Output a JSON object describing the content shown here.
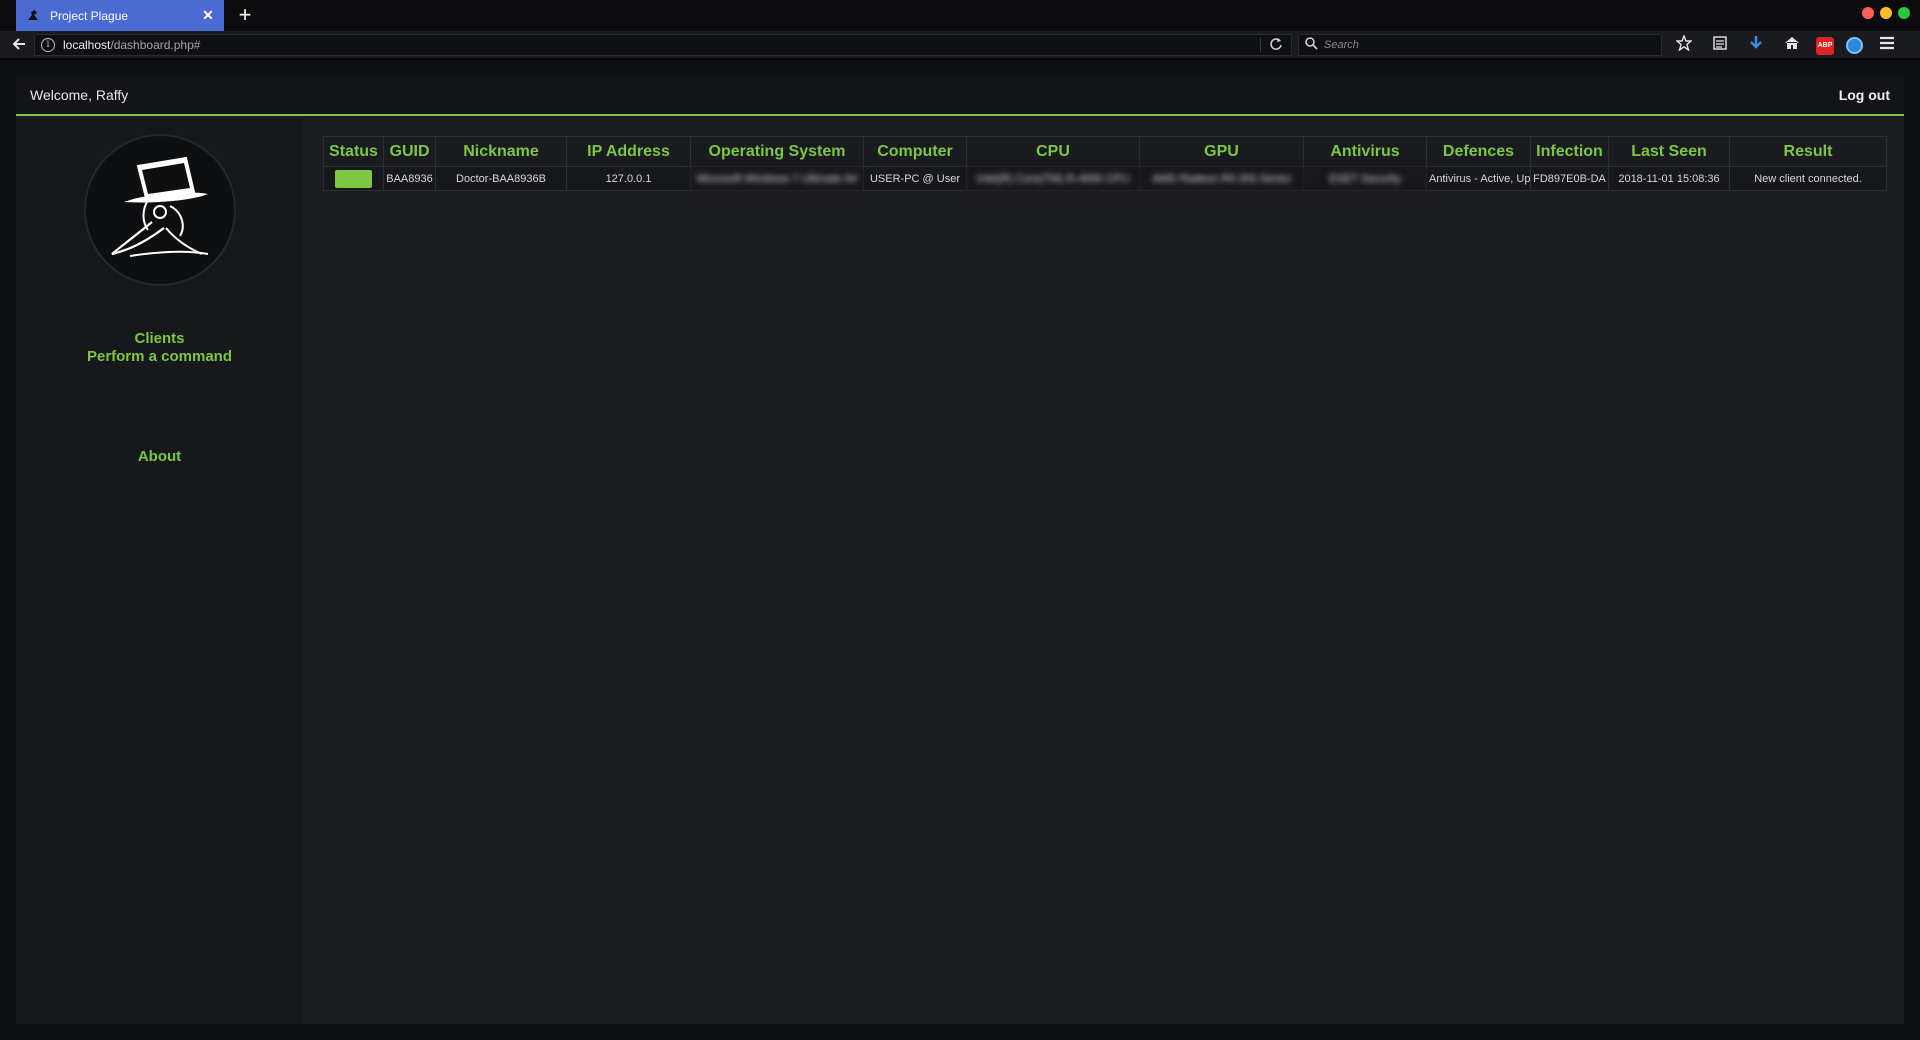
{
  "browser": {
    "tab_title": "Project Plague",
    "url_host": "localhost",
    "url_path": "/dashboard.php#",
    "search_placeholder": "Search",
    "abp_label": "ABP"
  },
  "header": {
    "welcome": "Welcome, Raffy",
    "logout": "Log out"
  },
  "sidebar": {
    "items": [
      {
        "label": "Clients"
      },
      {
        "label": "Perform a command"
      },
      {
        "label": "About"
      }
    ]
  },
  "table": {
    "columns": [
      "Status",
      "GUID",
      "Nickname",
      "IP Address",
      "Operating System",
      "Computer",
      "CPU",
      "GPU",
      "Antivirus",
      "Defences",
      "Infection",
      "Last Seen",
      "Result"
    ],
    "rows": [
      {
        "status": "online",
        "guid": "BAA8936",
        "nickname": "Doctor-BAA8936B",
        "ip": "127.0.0.1",
        "os": "Microsoft Windows 7 Ultimate 64",
        "computer": "USER-PC @ User",
        "cpu": "Intel(R) Core(TM) i5-4690 CPU",
        "gpu": "AMD Radeon R9 300 Series",
        "antivirus": "ESET Security",
        "defences": "Antivirus - Active, Up",
        "infection": "FD897E0B-DA",
        "last_seen": "2018-11-01 15:08:36",
        "result": "New client connected."
      }
    ]
  },
  "colors": {
    "accent": "#7dc742",
    "tab_active": "#4a6bd1",
    "background": "#1c1d21"
  }
}
